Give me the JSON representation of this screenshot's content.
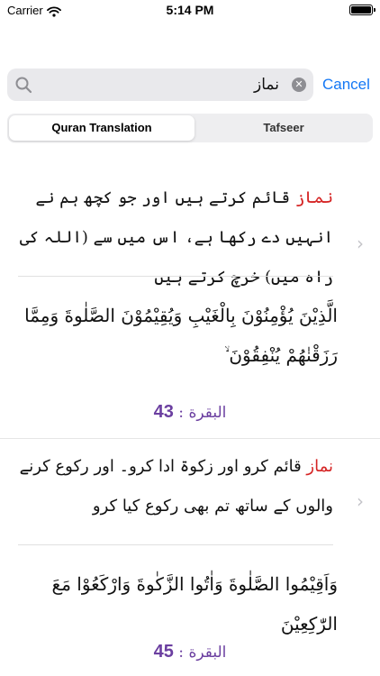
{
  "status_bar": {
    "carrier": "Carrier",
    "time": "5:14 PM"
  },
  "search": {
    "query": "نماز",
    "placeholder": "",
    "cancel_label": "Cancel"
  },
  "tabs": [
    {
      "label": "Quran Translation",
      "selected": true
    },
    {
      "label": "Tafseer",
      "selected": false
    }
  ],
  "results": [
    {
      "keyword": "نماز",
      "translation_rest": " قائم کرتے ہیں اور جو کچھ ہم نے انہیں دے رکھا ہے، اس میں سے (اللہ کی راہ میں) خرچ کرتے ہیں",
      "arabic": "الَّذِيْنَ يُؤْمِنُوْنَ بِالْغَيْبِ وَيُقِيْمُوْنَ الصَّلٰوةَ وَمِمَّا رَزَقْنٰهُمْ يُنْفِقُوْنَ ۙ",
      "surah": "البقرة",
      "separator": " : ",
      "ayah": "43"
    },
    {
      "keyword": "نماز",
      "translation_rest": " قائم کرو اور زکوۃ ادا کرو۔ اور رکوع کرنے والوں کے ساتھ تم بھی رکوع کیا کرو",
      "arabic": "وَاَقِيْمُوا الصَّلٰوةَ وَاٰتُوا الزَّكٰوةَ وَارْكَعُوْا مَعَ الرّٰكِعِيْنَ",
      "surah": "البقرة",
      "separator": " : ",
      "ayah": "45"
    }
  ],
  "colors": {
    "accent": "#1478f5",
    "keyword_highlight": "#d52424",
    "reference": "#6b3fa0"
  },
  "icons": {
    "search": "search-icon",
    "clear": "clear-icon",
    "chevron": "chevron-right-icon",
    "wifi": "wifi-icon",
    "battery": "battery-icon"
  }
}
